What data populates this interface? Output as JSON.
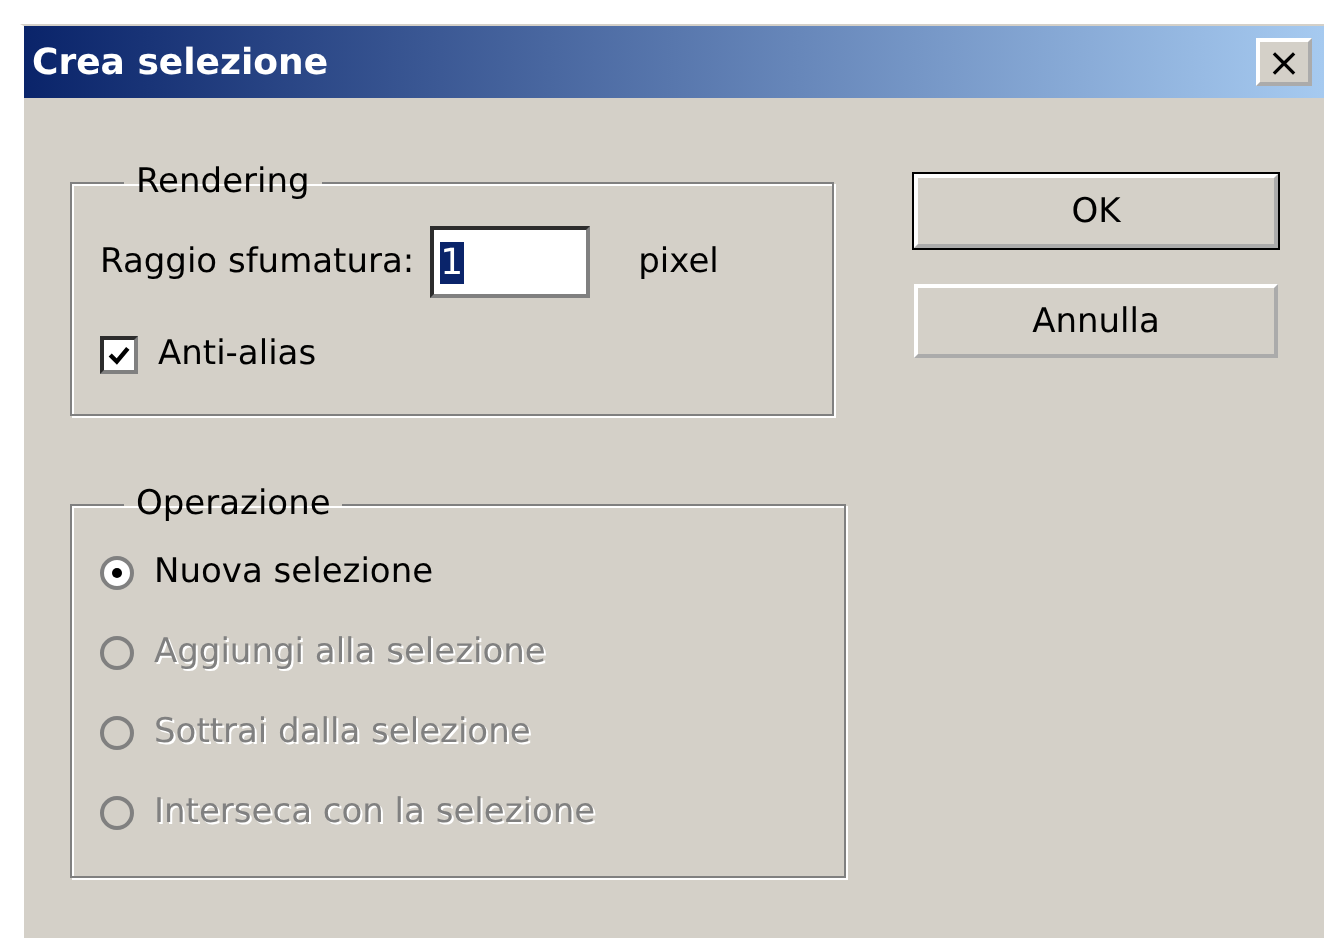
{
  "window": {
    "title": "Crea selezione",
    "close": "×"
  },
  "rendering": {
    "legend": "Rendering",
    "radius_label": "Raggio sfumatura:",
    "radius_value": "1",
    "unit": "pixel",
    "antialias": {
      "label": "Anti-alias",
      "checked": true
    }
  },
  "operation": {
    "legend": "Operazione",
    "options": [
      {
        "label": "Nuova selezione",
        "selected": true,
        "disabled": false
      },
      {
        "label": "Aggiungi alla selezione",
        "selected": false,
        "disabled": true
      },
      {
        "label": "Sottrai dalla selezione",
        "selected": false,
        "disabled": true
      },
      {
        "label": "Interseca con la selezione",
        "selected": false,
        "disabled": true
      }
    ]
  },
  "buttons": [
    {
      "label": "OK",
      "kind": "default"
    },
    {
      "label": "Annulla",
      "kind": "normal"
    }
  ]
}
